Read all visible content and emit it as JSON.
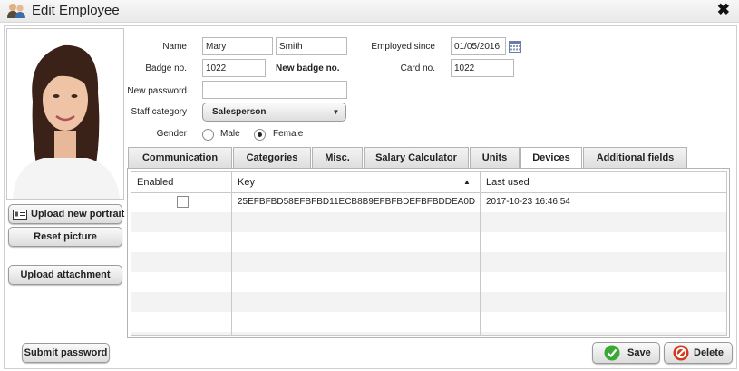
{
  "window": {
    "title": "Edit Employee",
    "close_label": "✖"
  },
  "left": {
    "upload_portrait": "Upload new portrait",
    "reset_picture": "Reset picture",
    "upload_attachment": "Upload attachment",
    "submit_password": "Submit password"
  },
  "form": {
    "name_label": "Name",
    "first_name": "Mary",
    "last_name": "Smith",
    "employed_since_label": "Employed since",
    "employed_since": "01/05/2016",
    "badge_label": "Badge no.",
    "badge": "1022",
    "new_badge_label": "New badge no.",
    "card_label": "Card no.",
    "card": "1022",
    "new_password_label": "New password",
    "new_password": "",
    "staff_category_label": "Staff category",
    "staff_category": "Salesperson",
    "gender_label": "Gender",
    "gender_male": "Male",
    "gender_female": "Female",
    "gender_selected": "Female"
  },
  "tabs": [
    {
      "label": "Communication"
    },
    {
      "label": "Categories"
    },
    {
      "label": "Misc."
    },
    {
      "label": "Salary Calculator"
    },
    {
      "label": "Units"
    },
    {
      "label": "Devices"
    },
    {
      "label": "Additional fields"
    }
  ],
  "active_tab": "Devices",
  "devices": {
    "columns": [
      "Enabled",
      "Key",
      "Last used"
    ],
    "sort_indicator": "▲",
    "rows": [
      {
        "enabled": false,
        "key": "25EFBFBD58EFBFBD11ECB8B9EFBFBDEFBFBDDEA0D",
        "last_used": "2017-10-23 16:46:54"
      }
    ]
  },
  "footer": {
    "save": "Save",
    "delete": "Delete"
  },
  "colors": {
    "save_icon": "#3aa835",
    "delete_icon": "#d2381e"
  }
}
